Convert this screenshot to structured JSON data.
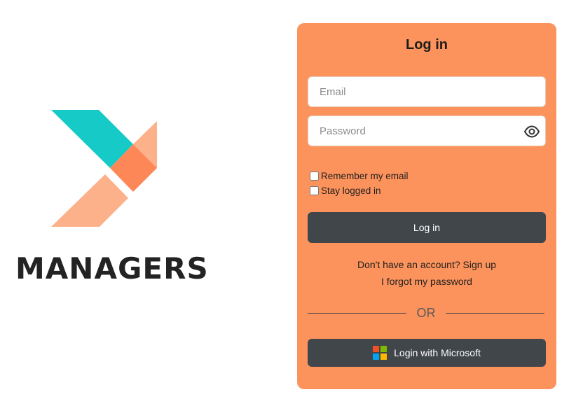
{
  "brand": {
    "name": "MANAGERS",
    "colors": {
      "teal": "#16cbc7",
      "peach": "#fdb18b",
      "orange": "#fd8757"
    }
  },
  "login": {
    "title": "Log in",
    "email_placeholder": "Email",
    "password_placeholder": "Password",
    "show_password_icon": "eye-icon",
    "remember_label": "Remember my email",
    "stay_label": "Stay logged in",
    "submit_label": "Log in",
    "signup_prompt": "Don't have an account?",
    "signup_link": "Sign up",
    "forgot_link": "I forgot my password",
    "divider_text": "OR",
    "microsoft_label": "Login with Microsoft",
    "microsoft_icon": "microsoft-logo-icon"
  },
  "colors": {
    "card_background": "#fd935c",
    "button_dark": "#41464b",
    "microsoft": [
      "#f25022",
      "#7fba00",
      "#00a4ef",
      "#ffb900"
    ]
  }
}
